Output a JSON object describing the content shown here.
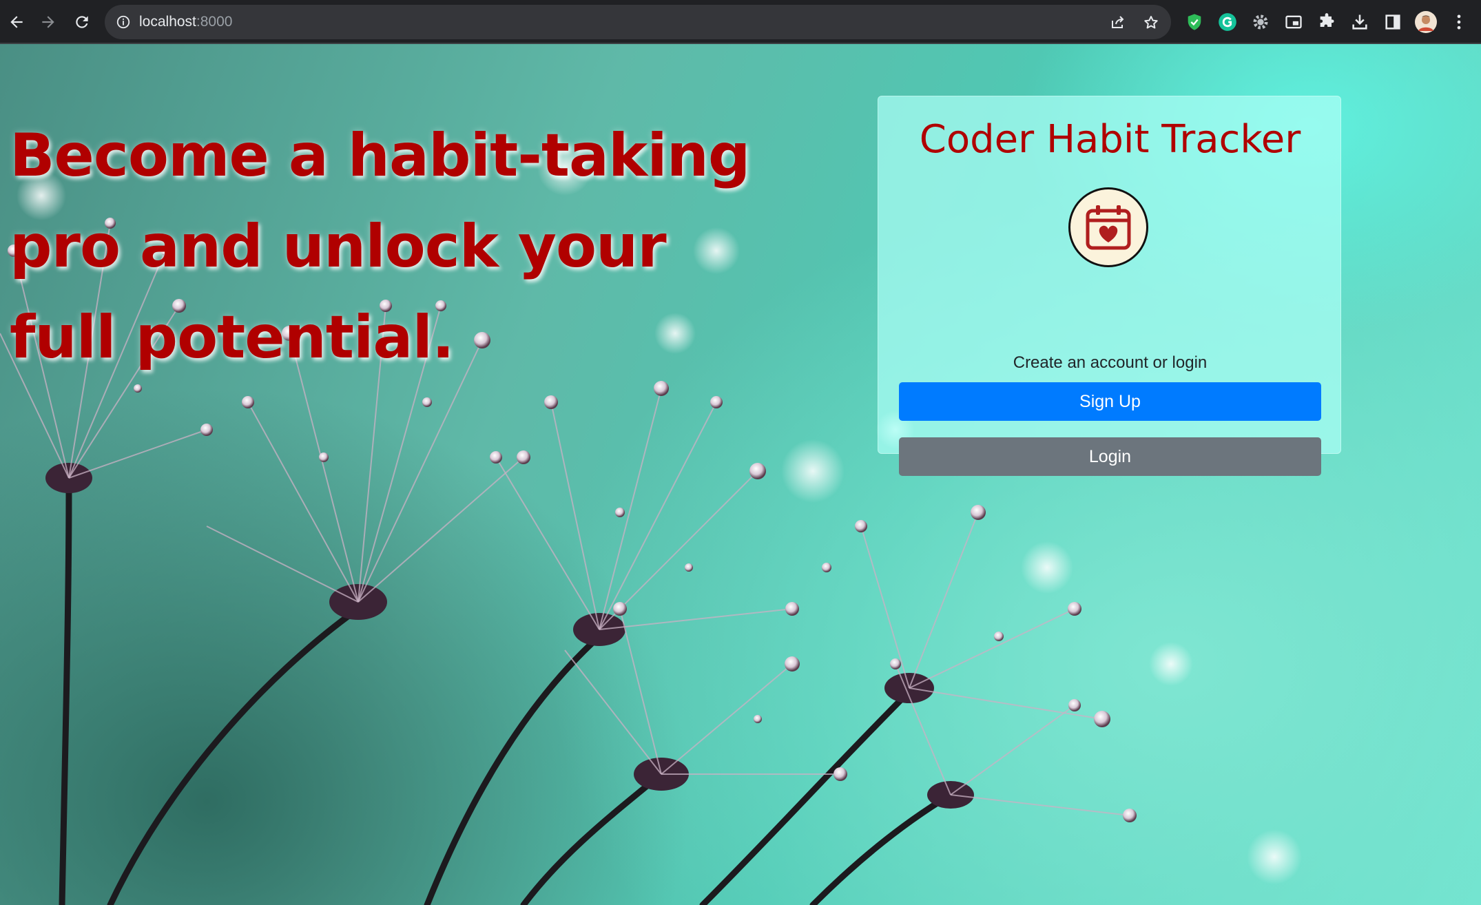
{
  "browser": {
    "url_host": "localhost",
    "url_port": ":8000",
    "icons": [
      "back-icon",
      "forward-icon",
      "reload-icon",
      "site-info-icon",
      "share-icon",
      "bookmark-star-icon",
      "shield-extension-icon",
      "grammarly-extension-icon",
      "gear-extension-icon",
      "picture-in-picture-icon",
      "extensions-puzzle-icon",
      "download-icon",
      "side-panel-icon",
      "profile-avatar",
      "more-menu-icon"
    ]
  },
  "hero": {
    "headline": "Become a habit-taking pro and unlock your full potential."
  },
  "card": {
    "title": "Coder Habit Tracker",
    "logo_icon": "calendar-heart-icon",
    "subtitle": "Create an account or login",
    "signup_label": "Sign Up",
    "login_label": "Login"
  },
  "colors": {
    "headline": "#b00000",
    "card_bg": "#aafff5",
    "signup_button": "#007bff",
    "login_button": "#6c757d",
    "chrome_bg": "#202124"
  }
}
